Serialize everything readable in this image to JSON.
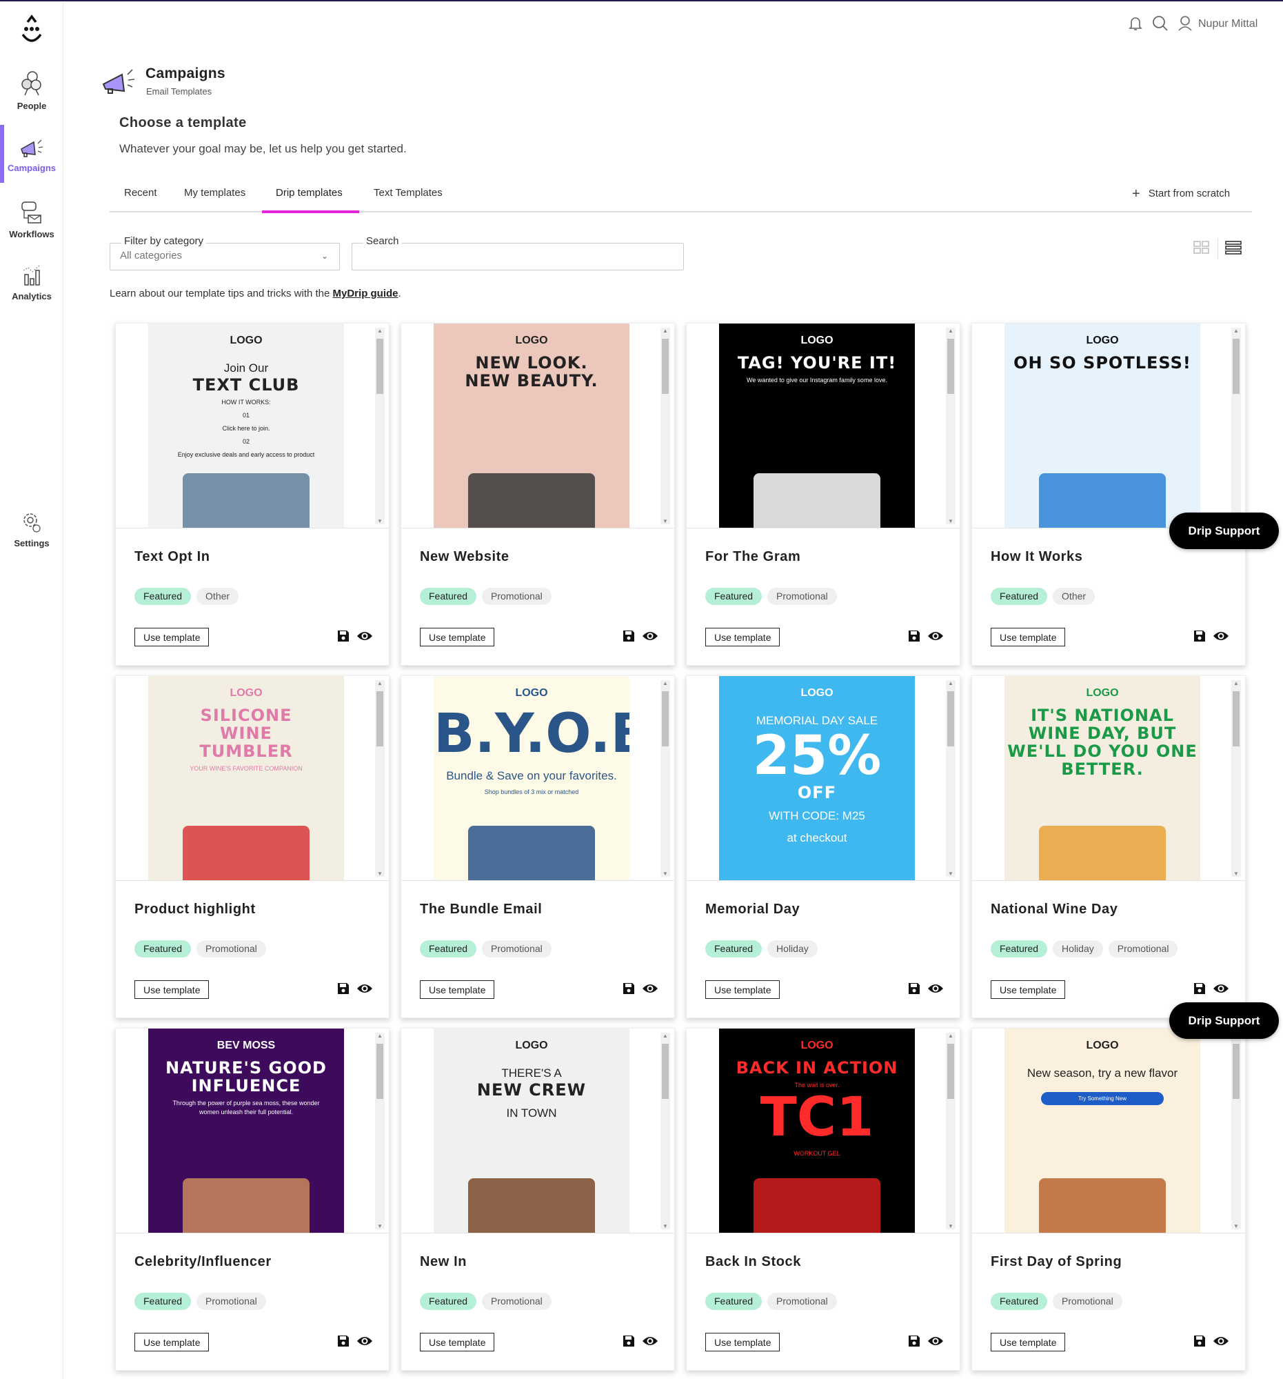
{
  "user": {
    "name": "Nupur Mittal"
  },
  "sidebar": {
    "items": [
      {
        "label": "People",
        "icon": "people-icon"
      },
      {
        "label": "Campaigns",
        "icon": "megaphone-icon",
        "active": true
      },
      {
        "label": "Workflows",
        "icon": "workflow-icon"
      },
      {
        "label": "Analytics",
        "icon": "analytics-icon"
      },
      {
        "label": "Settings",
        "icon": "gear-icon"
      }
    ]
  },
  "header": {
    "title": "Campaigns",
    "subtitle": "Email Templates"
  },
  "intro": {
    "title": "Choose a template",
    "subtitle": "Whatever your goal may be, let us help you get started."
  },
  "tabs": [
    {
      "label": "Recent"
    },
    {
      "label": "My templates"
    },
    {
      "label": "Drip templates",
      "active": true
    },
    {
      "label": "Text Templates"
    }
  ],
  "start_from_scratch": "Start from scratch",
  "filters": {
    "category_label": "Filter by category",
    "category_value": "All categories",
    "search_label": "Search",
    "search_value": ""
  },
  "learn": {
    "text": "Learn about our template tips and tricks with the ",
    "link": "MyDrip guide",
    "suffix": "."
  },
  "card_actions": {
    "use_template": "Use template"
  },
  "drip_support": "Drip Support",
  "colors": {
    "accent": "#8b6cf5",
    "tab_underline": "#e026d8",
    "featured_tag": "#b5f0d6"
  },
  "templates": [
    {
      "title": "Text Opt In",
      "tags": [
        "Featured",
        "Other"
      ],
      "preview": {
        "bg": "#f2f2f2",
        "fg": "#222",
        "lines": [
          [
            "logo-t",
            "LOGO"
          ],
          [
            "h2",
            "Join Our"
          ],
          [
            "h1",
            "TEXT CLUB"
          ],
          [
            "sm",
            "HOW IT WORKS:"
          ],
          [
            "sm",
            "01"
          ],
          [
            "sm",
            "Click here to join."
          ],
          [
            "sm",
            "02"
          ],
          [
            "sm",
            "Enjoy exclusive deals and early access to product"
          ]
        ],
        "img": "#5f7f9a"
      }
    },
    {
      "title": "New Website",
      "tags": [
        "Featured",
        "Promotional"
      ],
      "preview": {
        "bg": "#ebc7bc",
        "fg": "#222",
        "lines": [
          [
            "logo-t",
            "LOGO"
          ],
          [
            "h1",
            "NEW LOOK."
          ],
          [
            "h1",
            "NEW BEAUTY."
          ]
        ],
        "img": "#3a3a3a"
      }
    },
    {
      "title": "For The Gram",
      "tags": [
        "Featured",
        "Promotional"
      ],
      "preview": {
        "bg": "#000000",
        "fg": "#ffffff",
        "lines": [
          [
            "logo-t",
            "LOGO"
          ],
          [
            "h1",
            "TAG! YOU'RE IT!"
          ],
          [
            "sm",
            "We wanted to give our Instagram family some love."
          ]
        ],
        "img": "#ffffff"
      }
    },
    {
      "title": "How It Works",
      "tags": [
        "Featured",
        "Other"
      ],
      "preview": {
        "bg": "#e6f2fc",
        "fg": "#111",
        "lines": [
          [
            "logo-t",
            "LOGO"
          ],
          [
            "h1",
            "OH SO SPOTLESS!"
          ]
        ],
        "img": "#2c83d6"
      }
    },
    {
      "title": "Product highlight",
      "tags": [
        "Featured",
        "Promotional"
      ],
      "preview": {
        "bg": "#f2efe2",
        "fg": "#e07aa8",
        "lines": [
          [
            "logo-t",
            "LOGO"
          ],
          [
            "h1",
            "SILICONE"
          ],
          [
            "h1",
            "WINE"
          ],
          [
            "h1",
            "TUMBLER"
          ],
          [
            "sm",
            "YOUR WINE'S FAVORITE COMPANION"
          ]
        ],
        "img": "#d83a3a"
      }
    },
    {
      "title": "The Bundle Email",
      "tags": [
        "Featured",
        "Promotional"
      ],
      "preview": {
        "bg": "#fdfbe8",
        "fg": "#2a5588",
        "lines": [
          [
            "logo-t",
            "LOGO"
          ],
          [
            "big",
            "B.Y.O.B"
          ],
          [
            "h2",
            "Bundle & Save on your favorites."
          ],
          [
            "sm",
            "Shop bundles of 3 mix or matched"
          ]
        ],
        "img": "#2a5588"
      }
    },
    {
      "title": "Memorial Day",
      "tags": [
        "Featured",
        "Holiday"
      ],
      "preview": {
        "bg": "#3fb8f0",
        "fg": "#ffffff",
        "lines": [
          [
            "logo-t",
            "LOGO"
          ],
          [
            "h2",
            "MEMORIAL DAY SALE"
          ],
          [
            "big",
            "25%"
          ],
          [
            "h1",
            "OFF"
          ],
          [
            "h2",
            "WITH CODE: M25"
          ],
          [
            "h2",
            "at checkout"
          ]
        ],
        "img": ""
      }
    },
    {
      "title": "National Wine Day",
      "tags": [
        "Featured",
        "Holiday",
        "Promotional"
      ],
      "preview": {
        "bg": "#f3eedf",
        "fg": "#1a9a46",
        "lines": [
          [
            "logo-t",
            "LOGO"
          ],
          [
            "h1",
            "IT'S NATIONAL WINE DAY, BUT WE'LL DO YOU ONE BETTER."
          ]
        ],
        "img": "#e8a13a"
      }
    },
    {
      "title": "Celebrity/Influencer",
      "tags": [
        "Featured",
        "Promotional"
      ],
      "preview": {
        "bg": "#3d0a5c",
        "fg": "#ffffff",
        "lines": [
          [
            "logo-t",
            "BEV MOSS"
          ],
          [
            "h1",
            "NATURE'S GOOD INFLUENCE"
          ],
          [
            "sm",
            "Through the power of purple sea moss, these wonder women unleash their full potential."
          ]
        ],
        "img": "#c88a5a"
      }
    },
    {
      "title": "New In",
      "tags": [
        "Featured",
        "Promotional"
      ],
      "preview": {
        "bg": "#f0f0f0",
        "fg": "#222",
        "lines": [
          [
            "logo-t",
            "LOGO"
          ],
          [
            "h2",
            "THERE'S A"
          ],
          [
            "h1",
            "NEW CREW"
          ],
          [
            "h2",
            "IN TOWN"
          ]
        ],
        "img": "#7a4a2a"
      }
    },
    {
      "title": "Back In Stock",
      "tags": [
        "Featured",
        "Promotional"
      ],
      "preview": {
        "bg": "#000000",
        "fg": "#ff2a2a",
        "lines": [
          [
            "logo-t",
            "LOGO"
          ],
          [
            "h1",
            "BACK IN ACTION"
          ],
          [
            "sm",
            "The wait is over."
          ],
          [
            "big",
            "TC1"
          ],
          [
            "sm",
            "WORKOUT GEL"
          ]
        ],
        "img": "#d41e1e"
      }
    },
    {
      "title": "First Day of Spring",
      "tags": [
        "Featured",
        "Promotional"
      ],
      "preview": {
        "bg": "#fbf0de",
        "fg": "#222",
        "lines": [
          [
            "logo-t",
            "LOGO"
          ],
          [
            "h2",
            "New season, try a new flavor"
          ],
          [
            "btn",
            "Try Something New"
          ]
        ],
        "img": "#b8652e"
      }
    }
  ]
}
